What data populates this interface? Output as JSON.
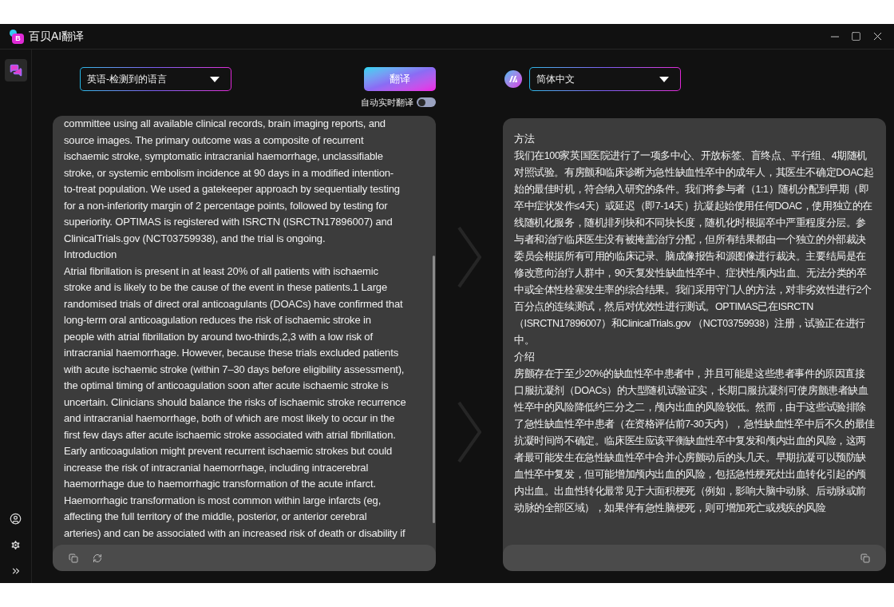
{
  "window": {
    "title": "百贝AI翻译",
    "logo_letter": "B"
  },
  "sidebar": {
    "items": [
      {
        "kind": "chat",
        "selected": true
      }
    ]
  },
  "source": {
    "language": "英语-检测到的语言",
    "lines": [
      "committee using all available clinical records, brain imaging reports, and",
      "source images. The primary outcome was a composite of recurrent",
      "ischaemic stroke, symptomatic intracranial haemorrhage, unclassifiable",
      "stroke, or systemic embolism incidence at 90 days in a modified intention-",
      "to-treat population. We used a gatekeeper approach by sequentially testing",
      "for a non-inferiority margin of 2 percentage points, followed by testing for",
      "superiority. OPTIMAS is registered with ISRCTN (ISRCTN17896007) and",
      "ClinicalTrials.gov (NCT03759938), and the trial is ongoing.",
      "Introduction",
      "Atrial fibrillation is present in at least 20% of all patients with ischaemic",
      "stroke and is likely to be the cause of the event in these patients.1 Large",
      "randomised trials of direct oral anticoagulants (DOACs) have confirmed that",
      "long-term oral anticoagulation reduces the risk of ischaemic stroke in",
      "people with atrial fibrillation by around two-thirds,2,3 with a low risk of",
      "intracranial haemorrhage. However, because these trials excluded patients",
      "with acute ischaemic stroke (within 7–30 days before eligibility assessment),",
      "the optimal timing of anticoagulation soon after acute ischaemic stroke is",
      "uncertain. Clinicians should balance the risks of ischaemic stroke recurrence",
      "and intracranial haemorrhage, both of which are most likely to occur in the",
      "first few days after acute ischaemic stroke associated with atrial fibrillation.",
      "Early anticoagulation might prevent recurrent ischaemic strokes but could",
      "increase the risk of intracranial haemorrhage, including intracerebral",
      "haemorrhage due to haemorrhagic transformation of the acute infarct.",
      "Haemorrhagic transformation is most common within large infarcts (eg,",
      "affecting the full territory of the middle, posterior, or anterior cerebral",
      "arteries) and can be associated with an increased risk of death or disability if"
    ]
  },
  "translate_button": "翻译",
  "auto_translate": {
    "label": "自动实时翻译",
    "on": false
  },
  "target": {
    "language": "简体中文",
    "paragraphs": [
      "方法",
      "我们在100家英国医院进行了一项多中心、开放标签、盲终点、平行组、4期随机对照试验。有房颤和临床诊断为急性缺血性卒中的成年人，其医生不确定DOAC起始的最佳时机，符合纳入研究的条件。我们将参与者（1:1）随机分配到早期（即卒中症状发作≤4天）或延迟（即7-14天）抗凝起始使用任何DOAC，使用独立的在线随机化服务，随机排列块和不同块长度，随机化时根据卒中严重程度分层。参与者和治疗临床医生没有被掩盖治疗分配，但所有结果都由一个独立的外部裁决委员会根据所有可用的临床记录、脑成像报告和源图像进行裁决。主要结局是在修改意向治疗人群中，90天复发性缺血性卒中、症状性颅内出血、无法分类的卒中或全体性栓塞发生率的综合结果。我们采用守门人的方法，对非劣效性进行2个百分点的连续测试，然后对优效性进行测试。OPTIMAS已在ISRCTN （ISRCTN17896007）和ClinicalTrials.gov （NCT03759938）注册，试验正在进行中。",
      "介绍",
      "房颤存在于至少20%的缺血性卒中患者中，并且可能是这些患者事件的原因直接口服抗凝剂（DOACs）的大型随机试验证实，长期口服抗凝剂可使房颤患者缺血性卒中的风险降低约三分之二，颅内出血的风险较低。然而，由于这些试验排除了急性缺血性卒中患者（在资格评估前7-30天内），急性缺血性卒中后不久的最佳抗凝时间尚不确定。临床医生应该平衡缺血性卒中复发和颅内出血的风险，这两者最可能发生在急性缺血性卒中合并心房颤动后的头几天。早期抗凝可以预防缺血性卒中复发，但可能增加颅内出血的风险，包括急性梗死灶出血转化引起的颅内出血。出血性转化最常见于大面积梗死（例如，影响大脑中动脉、后动脉或前动脉的全部区域），如果伴有急性脑梗死，则可增加死亡或残疾的风险"
    ]
  }
}
